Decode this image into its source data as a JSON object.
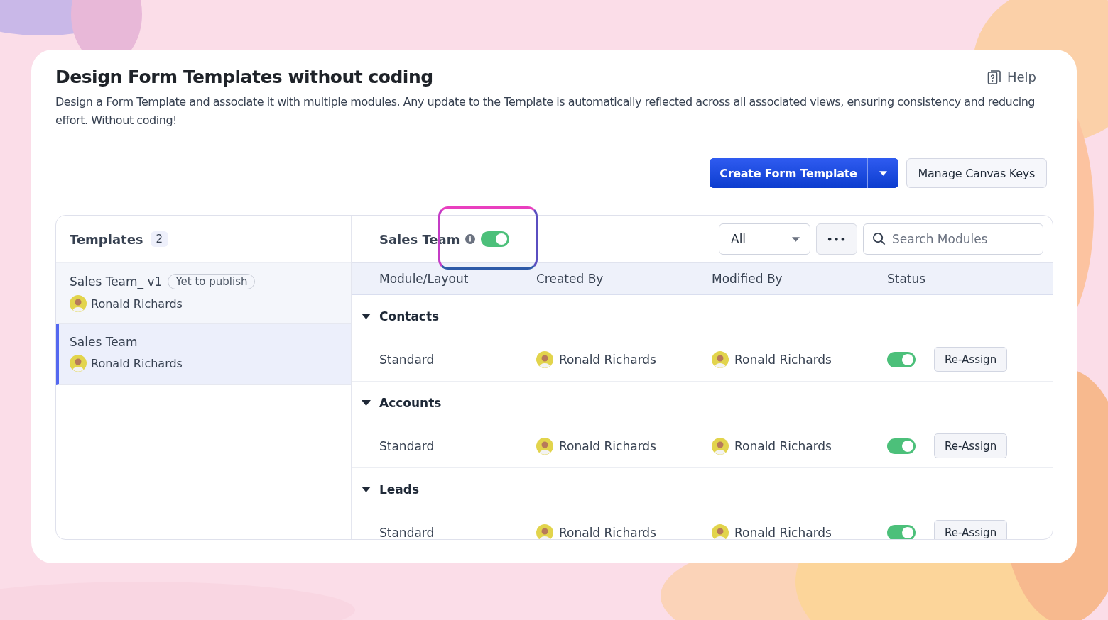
{
  "header": {
    "title": "Design Form Templates without coding",
    "help": "Help",
    "description": "Design a Form Template and associate it with multiple modules. Any update to the Template is automatically reflected across all associated views, ensuring consistency and reducing effort. Without coding!"
  },
  "actions": {
    "primary": "Create Form Template",
    "secondary": "Manage Canvas Keys"
  },
  "templates": {
    "title": "Templates",
    "count": "2",
    "items": [
      {
        "name": "Sales Team_ v1",
        "badge": "Yet to publish",
        "owner": "Ronald Richards",
        "selected": false
      },
      {
        "name": "Sales Team",
        "owner": "Ronald Richards",
        "selected": true
      }
    ]
  },
  "detail": {
    "title": "Sales Team",
    "enabled": true,
    "highlighted": true,
    "filter": "All",
    "more": "•••",
    "search": {
      "placeholder": "Search Modules"
    },
    "columns": [
      "Module/Layout",
      "Created By",
      "Modified By",
      "Status"
    ],
    "groups": [
      {
        "name": "Contacts",
        "expanded": true,
        "rows": [
          {
            "layout": "Standard",
            "created_by": "Ronald Richards",
            "modified_by": "Ronald Richards",
            "on": true,
            "action": "Re-Assign"
          }
        ]
      },
      {
        "name": "Accounts",
        "expanded": true,
        "rows": [
          {
            "layout": "Standard",
            "created_by": "Ronald Richards",
            "modified_by": "Ronald Richards",
            "on": true,
            "action": "Re-Assign"
          }
        ]
      },
      {
        "name": "Leads",
        "expanded": true,
        "rows": [
          {
            "layout": "Standard",
            "created_by": "Ronald Richards",
            "modified_by": "Ronald Richards",
            "on": true,
            "action": "Re-Assign"
          }
        ]
      }
    ]
  }
}
